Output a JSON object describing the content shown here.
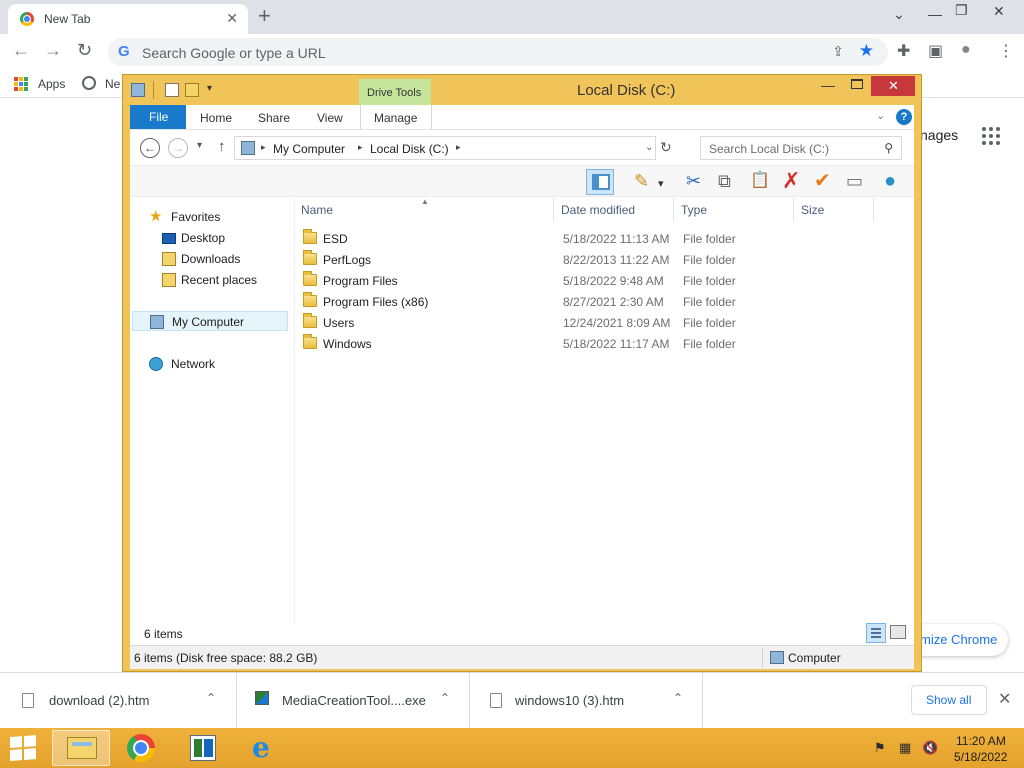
{
  "chrome": {
    "tab_title": "New Tab",
    "tab_close": "✕",
    "new_tab": "+",
    "window_controls": {
      "dropdown": "⌄",
      "minimize": "—",
      "restore": "❐",
      "close": "✕"
    },
    "nav": {
      "back": "←",
      "forward": "→",
      "reload": "↻"
    },
    "omnibox": {
      "logo": "G",
      "placeholder": "Search Google or type a URL",
      "share_icon": "⇪",
      "star_icon": "★"
    },
    "toolbar_icons": {
      "extensions": "✚",
      "sidepanel": "▣",
      "profile": "●",
      "menu": "⋮"
    },
    "bookmarks": {
      "apps_label": "Apps",
      "new_label": "Ne"
    },
    "page": {
      "images_link": "nages",
      "customize_label": "mize Chrome"
    }
  },
  "explorer": {
    "window_title": "Local Disk (C:)",
    "contextual_tab_group": "Drive Tools",
    "quick_access_dropdown": "▾",
    "close_glyph": "✕",
    "minimize_glyph": "—",
    "ribbon_tabs": {
      "file": "File",
      "home": "Home",
      "share": "Share",
      "view": "View",
      "manage": "Manage"
    },
    "ribbon_collapse": "⌄",
    "help": "?",
    "address": {
      "back": "←",
      "forward": "→",
      "recent_dropdown": "▾",
      "up": "↑",
      "segments": [
        "My Computer",
        "Local Disk (C:)"
      ],
      "chevron": "▸",
      "dropdown": "⌄",
      "refresh": "↻"
    },
    "search": {
      "placeholder": "Search Local Disk (C:)",
      "icon": "⚲"
    },
    "command_bar": [
      {
        "name": "preview-pane-button",
        "glyph": "",
        "icon": "layout-icon"
      },
      {
        "name": "properties-button",
        "glyph": "✎",
        "icon": "folder-properties-icon",
        "color": "#c98f14"
      },
      {
        "name": "properties-dropdown",
        "glyph": "▾",
        "icon": "chevron-down-icon",
        "color": "#333333"
      },
      {
        "name": "cut-button",
        "glyph": "✂",
        "icon": "scissors-icon",
        "color": "#2b6cb5"
      },
      {
        "name": "copy-button",
        "glyph": "⧉",
        "icon": "copy-icon",
        "color": "#666666"
      },
      {
        "name": "paste-button",
        "glyph": "📋",
        "icon": "clipboard-icon",
        "color": "#8b6a2a"
      },
      {
        "name": "delete-button",
        "glyph": "✗",
        "icon": "delete-icon",
        "color": "#d0312d"
      },
      {
        "name": "select-button",
        "glyph": "✔",
        "icon": "checkmark-icon",
        "color": "#e87b1a"
      },
      {
        "name": "rename-button",
        "glyph": "▭",
        "icon": "rename-icon",
        "color": "#777777"
      },
      {
        "name": "globe-button",
        "glyph": "●",
        "icon": "globe-icon",
        "color": "#2a8fc7"
      }
    ],
    "nav_pane": {
      "favorites": "Favorites",
      "desktop": "Desktop",
      "downloads": "Downloads",
      "recent_places": "Recent places",
      "my_computer": "My Computer",
      "network": "Network"
    },
    "columns": {
      "name": "Name",
      "date_modified": "Date modified",
      "type": "Type",
      "size": "Size",
      "sort_indicator": "▲"
    },
    "files": [
      {
        "name": "ESD",
        "date": "5/18/2022 11:13 AM",
        "type": "File folder"
      },
      {
        "name": "PerfLogs",
        "date": "8/22/2013 11:22 AM",
        "type": "File folder"
      },
      {
        "name": "Program Files",
        "date": "5/18/2022 9:48 AM",
        "type": "File folder"
      },
      {
        "name": "Program Files (x86)",
        "date": "8/27/2021 2:30 AM",
        "type": "File folder"
      },
      {
        "name": "Users",
        "date": "12/24/2021 8:09 AM",
        "type": "File folder"
      },
      {
        "name": "Windows",
        "date": "5/18/2022 11:17 AM",
        "type": "File folder"
      }
    ],
    "item_count": "6 items",
    "status_left": "6 items (Disk free space: 88.2 GB)",
    "status_right": "Computer"
  },
  "downloads": {
    "items": [
      {
        "name": "download (2).htm",
        "chevron": "⌃"
      },
      {
        "name": "MediaCreationTool....exe",
        "chevron": "⌃"
      },
      {
        "name": "windows10 (3).htm",
        "chevron": "⌃"
      }
    ],
    "show_all": "Show all",
    "close": "✕"
  },
  "taskbar": {
    "ie_glyph": "e",
    "tray": {
      "flag": "⚑",
      "network": "▦",
      "volume": "🔇"
    },
    "time": "11:20 AM",
    "date": "5/18/2022"
  }
}
